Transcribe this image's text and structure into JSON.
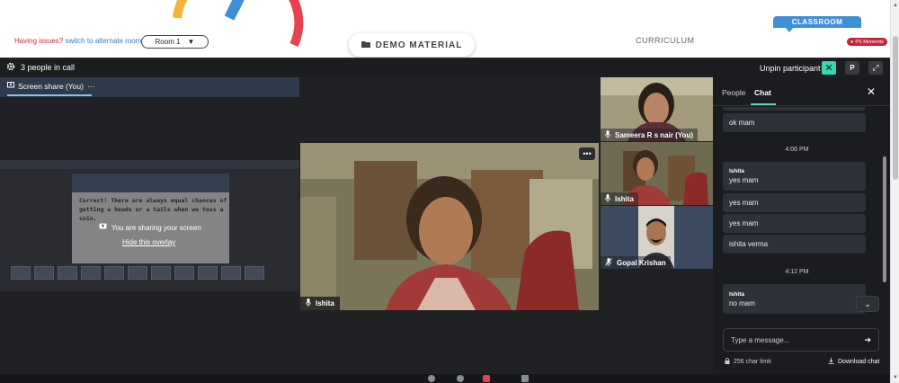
{
  "top": {
    "issue_prefix": "Having issues?",
    "issue_link": "switch to alternate room",
    "room_select": "Room 1",
    "demo_material": "DEMO MATERIAL",
    "curriculum": "CURRICULUM",
    "classroom": "CLASSROOM",
    "moments_badge": "PS Moments"
  },
  "meeting": {
    "people_count": "3 people in call",
    "unpin": "Unpin participant",
    "pin_toggle": "✕",
    "p_button": "P"
  },
  "share": {
    "label": "Screen share (You)",
    "menu": "···",
    "preview_text": "Correct! There are always equal chances of getting a heads or a tails when we toss a coin.",
    "sharing_text": "You are sharing your screen",
    "hide_overlay": "Hide this overlay"
  },
  "tiles": {
    "main_name": "Ishita",
    "main_menu": "•••",
    "tile1_name": "Sameera R s nair (You)",
    "tile2_name": "Ishita",
    "tile3_name": "Gopal Krishan"
  },
  "chat": {
    "tab_people": "People",
    "tab_chat": "Chat",
    "close": "✕",
    "messages": [
      {
        "text": "ok mam"
      },
      {
        "time": "4:06 PM"
      },
      {
        "sender": "Ishita",
        "text": "yes mam"
      },
      {
        "text": "yes mam"
      },
      {
        "text": "yes mam"
      },
      {
        "text": "ishita verma"
      },
      {
        "time": "4:12 PM"
      },
      {
        "sender": "Ishita",
        "text": "no mam"
      }
    ],
    "input_placeholder": "Type a message...",
    "char_limit": "256 char limit",
    "download": "Download chat"
  },
  "colors": {
    "accent_teal": "#35d6b1",
    "classroom_blue": "#3f8fd6",
    "badge_red": "#c8243a",
    "meeting_bg": "#202124"
  }
}
